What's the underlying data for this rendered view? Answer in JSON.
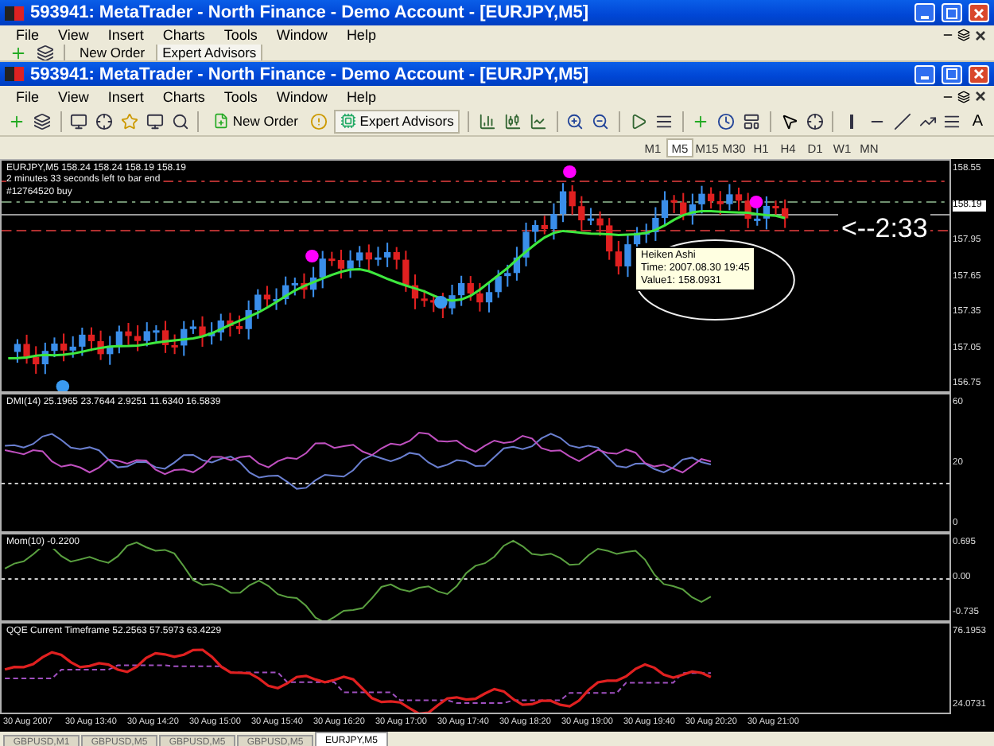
{
  "outer_window": {
    "title": "593941: MetaTrader - North Finance - Demo Account - [EURJPY,M5]",
    "menu": [
      "File",
      "View",
      "Insert",
      "Charts",
      "Tools",
      "Window",
      "Help"
    ],
    "toolbar": {
      "new_order": "New Order",
      "expert_advisors": "Expert Advisors"
    }
  },
  "window": {
    "title": "593941: MetaTrader - North Finance - Demo Account - [EURJPY,M5]",
    "menu": [
      "File",
      "View",
      "Insert",
      "Charts",
      "Tools",
      "Window",
      "Help"
    ],
    "toolbar": {
      "new_order": "New Order",
      "expert_advisors": "Expert Advisors",
      "text_tool": "A"
    },
    "timeframes": [
      {
        "label": "M1",
        "selected": false
      },
      {
        "label": "M5",
        "selected": true
      },
      {
        "label": "M15",
        "selected": false
      },
      {
        "label": "M30",
        "selected": false
      },
      {
        "label": "H1",
        "selected": false
      },
      {
        "label": "H4",
        "selected": false
      },
      {
        "label": "D1",
        "selected": false
      },
      {
        "label": "W1",
        "selected": false
      },
      {
        "label": "MN",
        "selected": false
      }
    ]
  },
  "price_pane": {
    "header": "EURJPY,M5  158.24 158.24 158.19 158.19",
    "bar_timer": "2 minutes 33 seconds left to bar end",
    "order_label": "#12764520 buy",
    "countdown": "<--2:33",
    "tooltip": [
      "Heiken Ashi",
      "Time: 2007.08.30 19:45",
      "Value1: 158.0931"
    ],
    "y_labels": [
      {
        "kind": "tick",
        "text": "158.55"
      },
      {
        "kind": "current",
        "text": "158.19"
      },
      {
        "kind": "tick",
        "text": "157.95"
      },
      {
        "kind": "tick",
        "text": "157.65"
      },
      {
        "kind": "tick",
        "text": "157.35"
      },
      {
        "kind": "tick",
        "text": "157.05"
      },
      {
        "kind": "tick",
        "text": "156.75"
      }
    ]
  },
  "dmi_pane": {
    "header": "DMI(14) 25.1965 23.7644 2.9251 11.6340 16.5839",
    "y_labels": [
      "60",
      "20",
      "0"
    ]
  },
  "mom_pane": {
    "header": "Mom(10) -0.2200",
    "y_labels": [
      "0.695",
      "0.00",
      "-0.735"
    ]
  },
  "qqe_pane": {
    "header": "QQE Current Timeframe 52.2563 57.5973 63.4229",
    "y_labels": [
      "76.1953",
      "24.0731"
    ]
  },
  "time_axis": [
    "30 Aug 2007",
    "30 Aug 13:40",
    "30 Aug 14:20",
    "30 Aug 15:00",
    "30 Aug 15:40",
    "30 Aug 16:20",
    "30 Aug 17:00",
    "30 Aug 17:40",
    "30 Aug 18:20",
    "30 Aug 19:00",
    "30 Aug 19:40",
    "30 Aug 20:20",
    "30 Aug 21:00"
  ],
  "tabs": [
    {
      "label": "GBPUSD,M1",
      "selected": false
    },
    {
      "label": "GBPUSD,M5",
      "selected": false
    },
    {
      "label": "GBPUSD,M5",
      "selected": false
    },
    {
      "label": "GBPUSD,M5",
      "selected": false
    },
    {
      "label": "EURJPY,M5",
      "selected": true
    }
  ]
}
